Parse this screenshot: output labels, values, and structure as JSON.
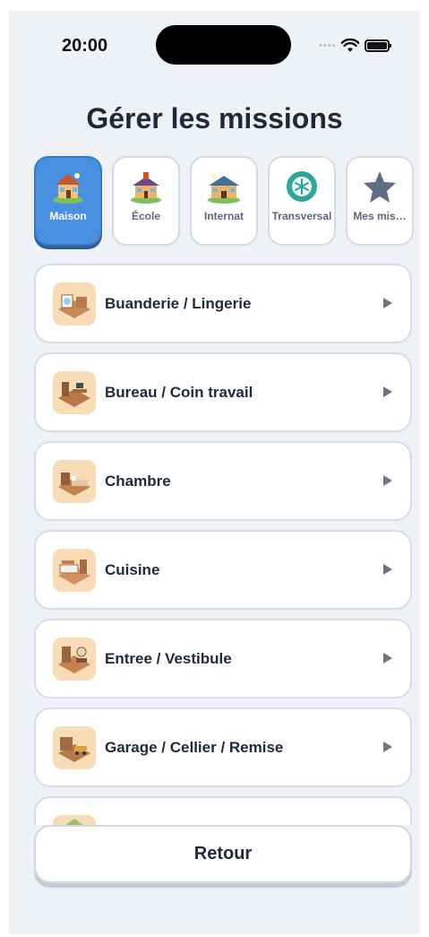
{
  "status": {
    "time": "20:00"
  },
  "page": {
    "title": "Gérer les missions"
  },
  "tabs": [
    {
      "label": "Maison",
      "icon": "house-icon",
      "active": true
    },
    {
      "label": "École",
      "icon": "school-icon",
      "active": false
    },
    {
      "label": "Internat",
      "icon": "boarding-house-icon",
      "active": false
    },
    {
      "label": "Transversal",
      "icon": "snowflake-badge-icon",
      "active": false
    },
    {
      "label": "Mes mis…",
      "icon": "star-icon",
      "active": false
    }
  ],
  "rooms": [
    {
      "label": "Buanderie / Lingerie",
      "icon": "laundry-room-icon"
    },
    {
      "label": "Bureau / Coin travail",
      "icon": "office-room-icon"
    },
    {
      "label": "Chambre",
      "icon": "bedroom-icon"
    },
    {
      "label": "Cuisine",
      "icon": "kitchen-icon"
    },
    {
      "label": "Entree / Vestibule",
      "icon": "entrance-icon"
    },
    {
      "label": "Garage / Cellier / Remise",
      "icon": "garage-icon"
    }
  ],
  "footer": {
    "back_label": "Retour"
  },
  "colors": {
    "accent": "#4a90e0",
    "background": "#eef2f7",
    "text": "#1e2a3a"
  }
}
